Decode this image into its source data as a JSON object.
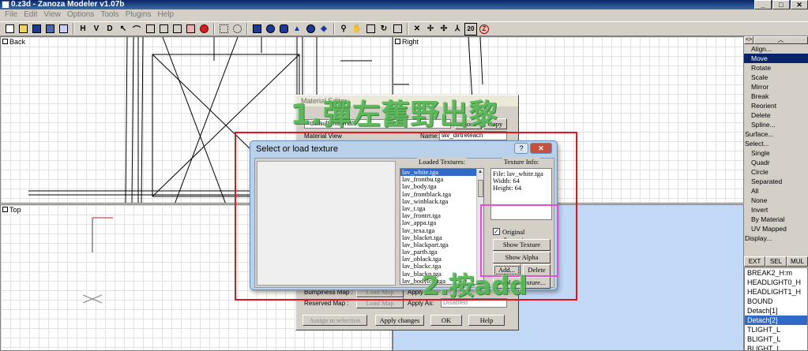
{
  "window": {
    "title": "0.z3d - Zanoza Modeler v1.07b",
    "btn_minimize": "_",
    "btn_maximize": "□",
    "btn_close": "✕"
  },
  "menu": [
    "File",
    "Edit",
    "View",
    "Options",
    "Tools",
    "Plugins",
    "Help"
  ],
  "toolbar": {
    "view_h": "H",
    "view_v": "V",
    "view_d": "D",
    "zoom_20_label": "20"
  },
  "viewports": {
    "back": "Back",
    "right": "Right",
    "top": "Top"
  },
  "right_panel": {
    "top_small": "<>",
    "top_up": "︿",
    "items": [
      {
        "label": "Align...",
        "head": false,
        "selected": false
      },
      {
        "label": "Move",
        "head": false,
        "selected": true
      },
      {
        "label": "Rotate",
        "head": false,
        "selected": false
      },
      {
        "label": "Scale",
        "head": false,
        "selected": false
      },
      {
        "label": "Mirror",
        "head": false,
        "selected": false
      },
      {
        "label": "Break",
        "head": false,
        "selected": false
      },
      {
        "label": "Reorient",
        "head": false,
        "selected": false
      },
      {
        "label": "Delete",
        "head": false,
        "selected": false
      },
      {
        "label": "Spline...",
        "head": false,
        "selected": false
      },
      {
        "label": "Surface...",
        "head": true,
        "selected": false
      },
      {
        "label": "Select...",
        "head": true,
        "selected": false
      },
      {
        "label": "Single",
        "head": false,
        "selected": false
      },
      {
        "label": "Quadr",
        "head": false,
        "selected": false
      },
      {
        "label": "Circle",
        "head": false,
        "selected": false
      },
      {
        "label": "Separated",
        "head": false,
        "selected": false
      },
      {
        "label": "All",
        "head": false,
        "selected": false
      },
      {
        "label": "None",
        "head": false,
        "selected": false
      },
      {
        "label": "Invert",
        "head": false,
        "selected": false
      },
      {
        "label": "By Material",
        "head": false,
        "selected": false
      },
      {
        "label": "UV Mapped",
        "head": false,
        "selected": false
      },
      {
        "label": "Display...",
        "head": true,
        "selected": false
      }
    ],
    "tabs": [
      "EXT",
      "SEL",
      "MUL"
    ],
    "objects": [
      {
        "label": "BREAK2_H:m",
        "selected": false
      },
      {
        "label": "HEADLIGHT0_H",
        "selected": false
      },
      {
        "label": "HEADLIGHT1_H",
        "selected": false
      },
      {
        "label": "BOUND",
        "selected": false
      },
      {
        "label": "Detach[1]",
        "selected": false
      },
      {
        "label": "Detach[2]",
        "selected": true
      },
      {
        "label": "TLIGHT_L",
        "selected": false
      },
      {
        "label": "BLIGHT_L",
        "selected": false
      },
      {
        "label": "BLIGHT_L",
        "selected": false
      }
    ]
  },
  "material_editor": {
    "title": "Material Editor",
    "combo_value": "<default material>",
    "clone_button": "Clone",
    "copy_button": "Copy",
    "material_view_label": "Material View",
    "name_label": "Name:",
    "name_value": "lav_dirtreteach",
    "bumpiness_label": "Bumpiness Map :",
    "load_map_1": "Load Map",
    "apply_1": "Apply ...",
    "reserved_label": "Reserved Map :",
    "load_map_2": "Load Map",
    "apply_as_label": "Apply As:",
    "apply_as_value": "Disabled",
    "assign_button": "Assign to selection",
    "apply_changes_button": "Apply changes",
    "ok_button": "OK",
    "help_button": "Help"
  },
  "dialog": {
    "title": "Select or load texture",
    "help_btn": "?",
    "close_btn": "✕",
    "loaded_textures_label": "Loaded Textures:",
    "textures": [
      "lav_white.tga",
      "lav_frontbu.tga",
      "lav_body.tga",
      "lav_frontblack.tga",
      "lav_winblack.tga",
      "lav_t.tga",
      "lav_frontrt.tga",
      "lav_appa.tga",
      "lav_texa.tga",
      "lav_blackrt.tga",
      "lav_blackpart.tga",
      "lav_partb.tga",
      "lav_oblack.tga",
      "lav_blackc.tga",
      "lav_blackp.tga",
      "lav_bodylo3.tga"
    ],
    "texture_info_label": "Texture Info:",
    "info_file": "File: lav_white.tga",
    "info_width": "Width: 64",
    "info_height": "Height: 64",
    "original_dimension_label": "Original dimension",
    "show_texture_button": "Show Texture",
    "show_alpha_button": "Show Alpha",
    "add_button": "Add...",
    "delete_button": "Delete",
    "replace_button": "Replace texture...",
    "cancel_partial": "Cancel"
  },
  "annotations": {
    "step1": "1.彈左舊野出黎",
    "step2": "2.按add"
  }
}
